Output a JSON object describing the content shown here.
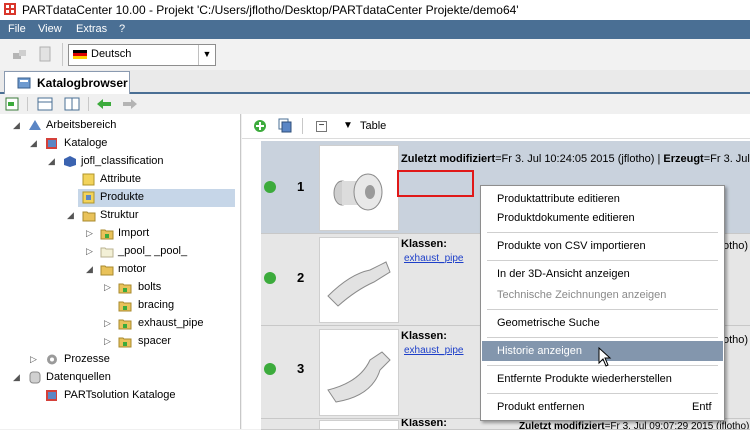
{
  "window": {
    "title": "PARTdataCenter 10.00 - Projekt 'C:/Users/jflotho/Desktop/PARTdataCenter Projekte/demo64'"
  },
  "menu": [
    "File",
    "View",
    "Extras",
    "?"
  ],
  "toolbar": {
    "language": "Deutsch"
  },
  "tab": {
    "label": "Katalogbrowser"
  },
  "tree": {
    "workspace": "Arbeitsbereich",
    "catalogs": "Kataloge",
    "classification": "jofl_classification",
    "attributes": "Attribute",
    "products": "Produkte",
    "structure": "Struktur",
    "import": "Import",
    "pool": "_pool_ _pool_",
    "motor": "motor",
    "bolts": "bolts",
    "bracing": "bracing",
    "exhaust_pipe": "exhaust_pipe",
    "spacer": "spacer",
    "processes": "Prozesse",
    "datasources": "Datenquellen",
    "partsolution": "PARTsolution Kataloge"
  },
  "list_toolbar": {
    "table_label": "Table"
  },
  "products": [
    {
      "num": "1",
      "mod_label": "Zuletzt modifiziert",
      "mod_value": "=Fr 3. Jul 10:24:05 2015 (jflotho) | ",
      "created_label": "Erzeugt",
      "created_value": "=Fr 3. Jul"
    },
    {
      "num": "2",
      "classes_label": "Klassen:",
      "link": "exhaust_pipe",
      "trail": "otho)"
    },
    {
      "num": "3",
      "classes_label": "Klassen:",
      "link": "exhaust_pipe",
      "trail": "otho)"
    },
    {
      "num": "4",
      "classes_label": "Klassen:",
      "bottom_text": "Zuletzt modifiziert",
      "bottom_value": "=Fr 3. Jul 09:07:29 2015 (jflotho)"
    }
  ],
  "context_menu": {
    "items": [
      "Produktattribute editieren",
      "Produktdokumente editieren",
      "Produkte von CSV importieren",
      "In der 3D-Ansicht anzeigen",
      "Technische Zeichnungen anzeigen",
      "Geometrische Suche",
      "Historie anzeigen",
      "Entfernte Produkte wiederherstellen",
      "Produkt entfernen"
    ],
    "shortcut_remove": "Entf",
    "highlighted_index": 6,
    "disabled_index": 4
  },
  "colors": {
    "menubar": "#4a6f94",
    "highlight": "#8396ad",
    "selection": "#c6d6e8",
    "check": "#3cab3c",
    "red": "#e01818"
  }
}
